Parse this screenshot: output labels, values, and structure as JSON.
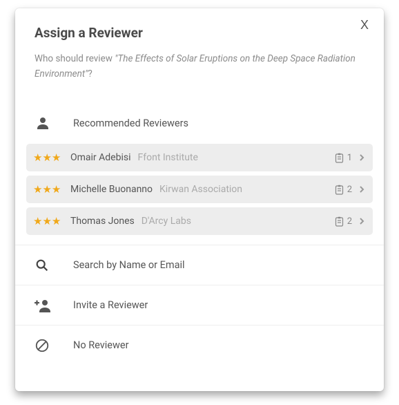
{
  "modal": {
    "title": "Assign a Reviewer",
    "close_label": "X",
    "subtitle_prefix": "Who should review ",
    "document_title": "\"The Effects of Solar Eruptions on the Deep Space Radiation Environment\"",
    "subtitle_suffix": "?"
  },
  "sections": {
    "recommended_label": "Recommended Reviewers",
    "search_label": "Search by Name or Email",
    "invite_label": "Invite a Reviewer",
    "noreviewer_label": "No Reviewer"
  },
  "reviewers": [
    {
      "stars": "★★★",
      "name": "Omair Adebisi",
      "affiliation": "Ffont Institute",
      "count": "1"
    },
    {
      "stars": "★★★",
      "name": "Michelle Buonanno",
      "affiliation": "Kirwan Association",
      "count": "2"
    },
    {
      "stars": "★★★",
      "name": "Thomas Jones",
      "affiliation": "D'Arcy Labs",
      "count": "2"
    }
  ],
  "colors": {
    "accent": "#f0a81a"
  }
}
